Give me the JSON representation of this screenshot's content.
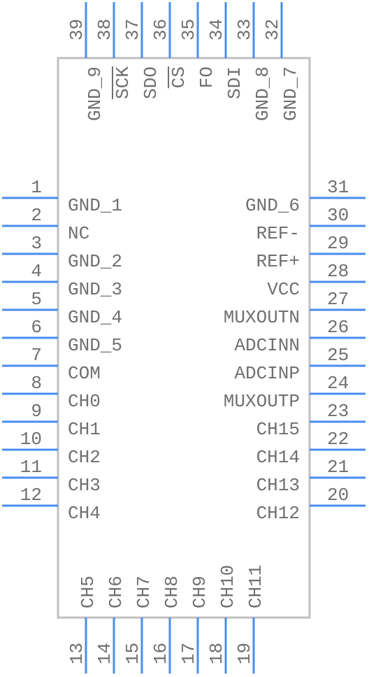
{
  "colors": {
    "pin": "#4a8cf0",
    "body_outline": "#c0c0c0",
    "text": "#707070"
  },
  "pins": {
    "left": [
      {
        "number": "1",
        "name": "GND_1"
      },
      {
        "number": "2",
        "name": "NC"
      },
      {
        "number": "3",
        "name": "GND_2"
      },
      {
        "number": "4",
        "name": "GND_3"
      },
      {
        "number": "5",
        "name": "GND_4"
      },
      {
        "number": "6",
        "name": "GND_5"
      },
      {
        "number": "7",
        "name": "COM"
      },
      {
        "number": "8",
        "name": "CH0"
      },
      {
        "number": "9",
        "name": "CH1"
      },
      {
        "number": "10",
        "name": "CH2"
      },
      {
        "number": "11",
        "name": "CH3"
      },
      {
        "number": "12",
        "name": "CH4"
      }
    ],
    "right": [
      {
        "number": "31",
        "name": "GND_6"
      },
      {
        "number": "30",
        "name": "REF-"
      },
      {
        "number": "29",
        "name": "REF+"
      },
      {
        "number": "28",
        "name": "VCC"
      },
      {
        "number": "27",
        "name": "MUXOUTN"
      },
      {
        "number": "26",
        "name": "ADCINN"
      },
      {
        "number": "25",
        "name": "ADCINP"
      },
      {
        "number": "24",
        "name": "MUXOUTP"
      },
      {
        "number": "23",
        "name": "CH15"
      },
      {
        "number": "22",
        "name": "CH14"
      },
      {
        "number": "21",
        "name": "CH13"
      },
      {
        "number": "20",
        "name": "CH12"
      }
    ],
    "top": [
      {
        "number": "39",
        "name": "GND_9"
      },
      {
        "number": "38",
        "name": "SCK",
        "overbar": true
      },
      {
        "number": "37",
        "name": "SDO"
      },
      {
        "number": "36",
        "name": "CS",
        "overbar": true
      },
      {
        "number": "35",
        "name": "FO"
      },
      {
        "number": "34",
        "name": "SDI"
      },
      {
        "number": "33",
        "name": "GND_8"
      },
      {
        "number": "32",
        "name": "GND_7"
      }
    ],
    "bottom": [
      {
        "number": "13",
        "name": "CH5"
      },
      {
        "number": "14",
        "name": "CH6"
      },
      {
        "number": "15",
        "name": "CH7"
      },
      {
        "number": "16",
        "name": "CH8"
      },
      {
        "number": "17",
        "name": "CH9"
      },
      {
        "number": "18",
        "name": "CH10"
      },
      {
        "number": "19",
        "name": "CH11"
      }
    ]
  }
}
